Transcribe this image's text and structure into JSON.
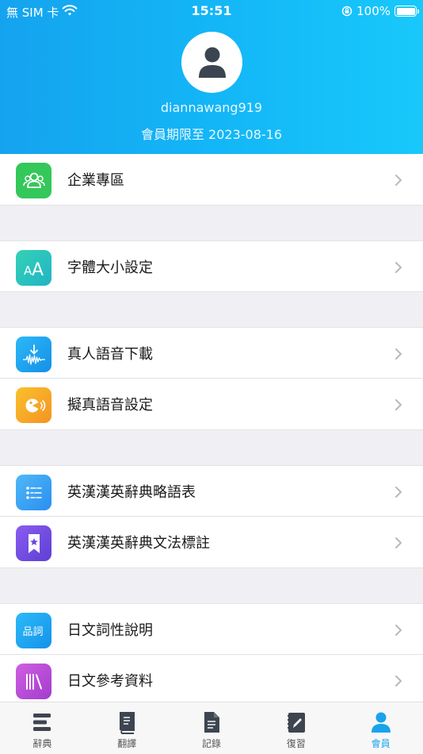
{
  "status_bar": {
    "carrier": "無 SIM 卡",
    "time": "15:51",
    "battery": "100%"
  },
  "profile": {
    "username": "diannawang919",
    "membership": "會員期限至 2023-08-16"
  },
  "menu": {
    "enterprise": "企業專區",
    "font_size": "字體大小設定",
    "voice_download": "真人語音下載",
    "tts_settings": "擬真語音設定",
    "abbreviations": "英漢漢英辭典略語表",
    "grammar_labels": "英漢漢英辭典文法標註",
    "jp_pos": "日文詞性說明",
    "jp_reference": "日文參考資料"
  },
  "tabs": {
    "dictionary": "辭典",
    "translate": "翻譯",
    "records": "記錄",
    "review": "復習",
    "member": "會員"
  },
  "colors": {
    "header_start": "#15a3ef",
    "header_end": "#18c8fb",
    "active_tab": "#1aa3ec",
    "enterprise_icon": "#34c759",
    "font_icon": "#2ec4b6",
    "voice_icon": "#1ea5f0",
    "tts_icon": "#f5a623",
    "abbr_icon": "#3ba6f5",
    "grammar_icon": "#7b4fe0",
    "jp_pos_icon": "#1fa9f0",
    "jp_ref_icon": "#c24fd6"
  }
}
